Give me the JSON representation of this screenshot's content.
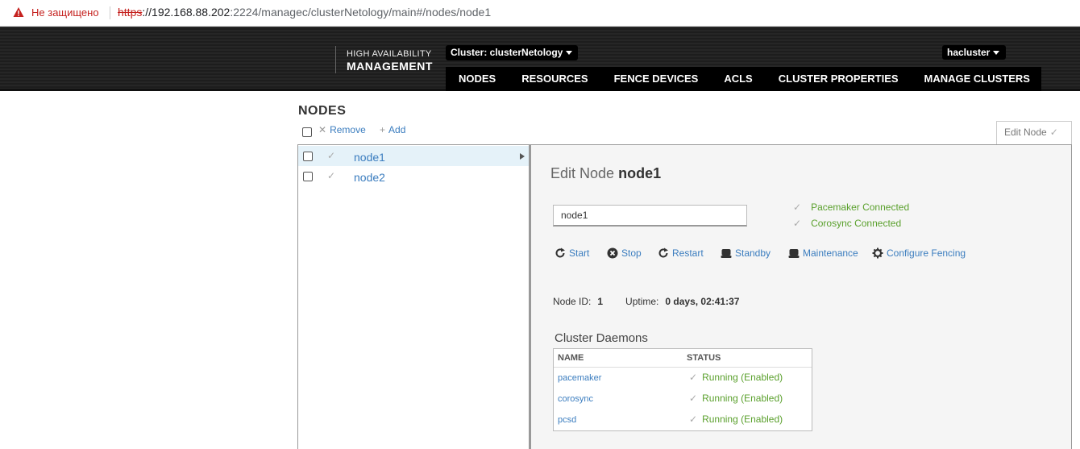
{
  "browser": {
    "security_text": "Не защищено",
    "url_proto": "https",
    "url_host": "://192.168.88.202",
    "url_path": ":2224/managec/clusterNetology/main#/nodes/node1"
  },
  "header": {
    "brand_top": "HIGH AVAILABILITY",
    "brand_main": "MANAGEMENT",
    "cluster_select": "Cluster: clusterNetology",
    "user": "hacluster",
    "nav": [
      "NODES",
      "RESOURCES",
      "FENCE DEVICES",
      "ACLS",
      "CLUSTER PROPERTIES",
      "MANAGE CLUSTERS"
    ]
  },
  "page": {
    "title": "NODES",
    "remove_label": "Remove",
    "add_label": "Add",
    "edit_tab_label": "Edit Node"
  },
  "nodes": [
    {
      "name": "node1",
      "selected": true
    },
    {
      "name": "node2",
      "selected": false
    }
  ],
  "detail": {
    "title_prefix": "Edit Node",
    "title_node": "node1",
    "input_value": "node1",
    "status": [
      "Pacemaker Connected",
      "Corosync Connected"
    ],
    "actions": [
      "Start",
      "Stop",
      "Restart",
      "Standby",
      "Maintenance",
      "Configure Fencing"
    ],
    "node_id_label": "Node ID:",
    "node_id": "1",
    "uptime_label": "Uptime:",
    "uptime": "0 days, 02:41:37",
    "daemons_title": "Cluster Daemons",
    "daemons_headers": [
      "NAME",
      "STATUS"
    ],
    "daemons": [
      {
        "name": "pacemaker",
        "status": "Running (Enabled)"
      },
      {
        "name": "corosync",
        "status": "Running (Enabled)"
      },
      {
        "name": "pcsd",
        "status": "Running (Enabled)"
      }
    ]
  },
  "colors": {
    "link": "#3b7dbf",
    "ok_green": "#5aa02c",
    "warning_red": "#c5221f",
    "selected_row": "#e5f2f9"
  }
}
